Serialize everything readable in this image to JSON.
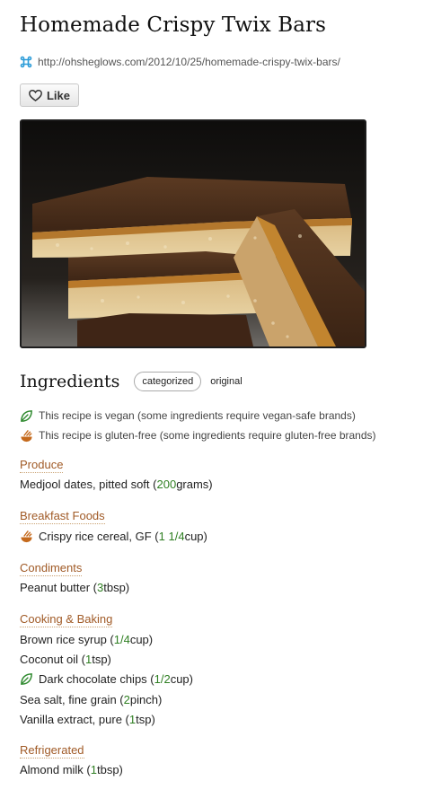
{
  "recipe": {
    "title": "Homemade Crispy Twix Bars",
    "url": "http://ohsheglows.com/2012/10/25/homemade-crispy-twix-bars/",
    "like_label": "Like",
    "image_alt": "Homemade crispy twix bars"
  },
  "ingredients": {
    "heading": "Ingredients",
    "view_categorized": "categorized",
    "view_original": "original",
    "notes": [
      {
        "icon": "leaf-icon",
        "text": "This recipe is vegan (some ingredients require vegan-safe brands)"
      },
      {
        "icon": "gluten-free-icon",
        "text": "This recipe is gluten-free (some ingredients require gluten-free brands)"
      }
    ],
    "categories": [
      {
        "name": "Produce",
        "items": [
          {
            "pre": "Medjool dates, pitted soft (",
            "qty": "200",
            "post": " grams)"
          }
        ]
      },
      {
        "name": "Breakfast Foods",
        "items": [
          {
            "pre": "Crispy rice cereal, GF (",
            "qty": "1 1/4",
            "post": " cup)",
            "icon": "gluten-free-icon"
          }
        ]
      },
      {
        "name": "Condiments",
        "items": [
          {
            "pre": "Peanut butter (",
            "qty": "3",
            "post": " tbsp)"
          }
        ]
      },
      {
        "name": "Cooking & Baking",
        "items": [
          {
            "pre": "Brown rice syrup (",
            "qty": "1/4",
            "post": " cup)"
          },
          {
            "pre": "Coconut oil (",
            "qty": "1",
            "post": " tsp)"
          },
          {
            "pre": "Dark chocolate chips (",
            "qty": "1/2",
            "post": " cup)",
            "icon": "leaf-icon"
          },
          {
            "pre": "Sea salt, fine grain (",
            "qty": "2",
            "post": " pinch)"
          },
          {
            "pre": "Vanilla extract, pure (",
            "qty": "1",
            "post": " tsp)"
          }
        ]
      },
      {
        "name": "Refrigerated",
        "items": [
          {
            "pre": "Almond milk (",
            "qty": "1",
            "post": " tbsp)"
          }
        ]
      }
    ]
  },
  "colors": {
    "section_link": "#a05a26",
    "quantity": "#2f7f22",
    "url_icon": "#2a9bd8"
  }
}
